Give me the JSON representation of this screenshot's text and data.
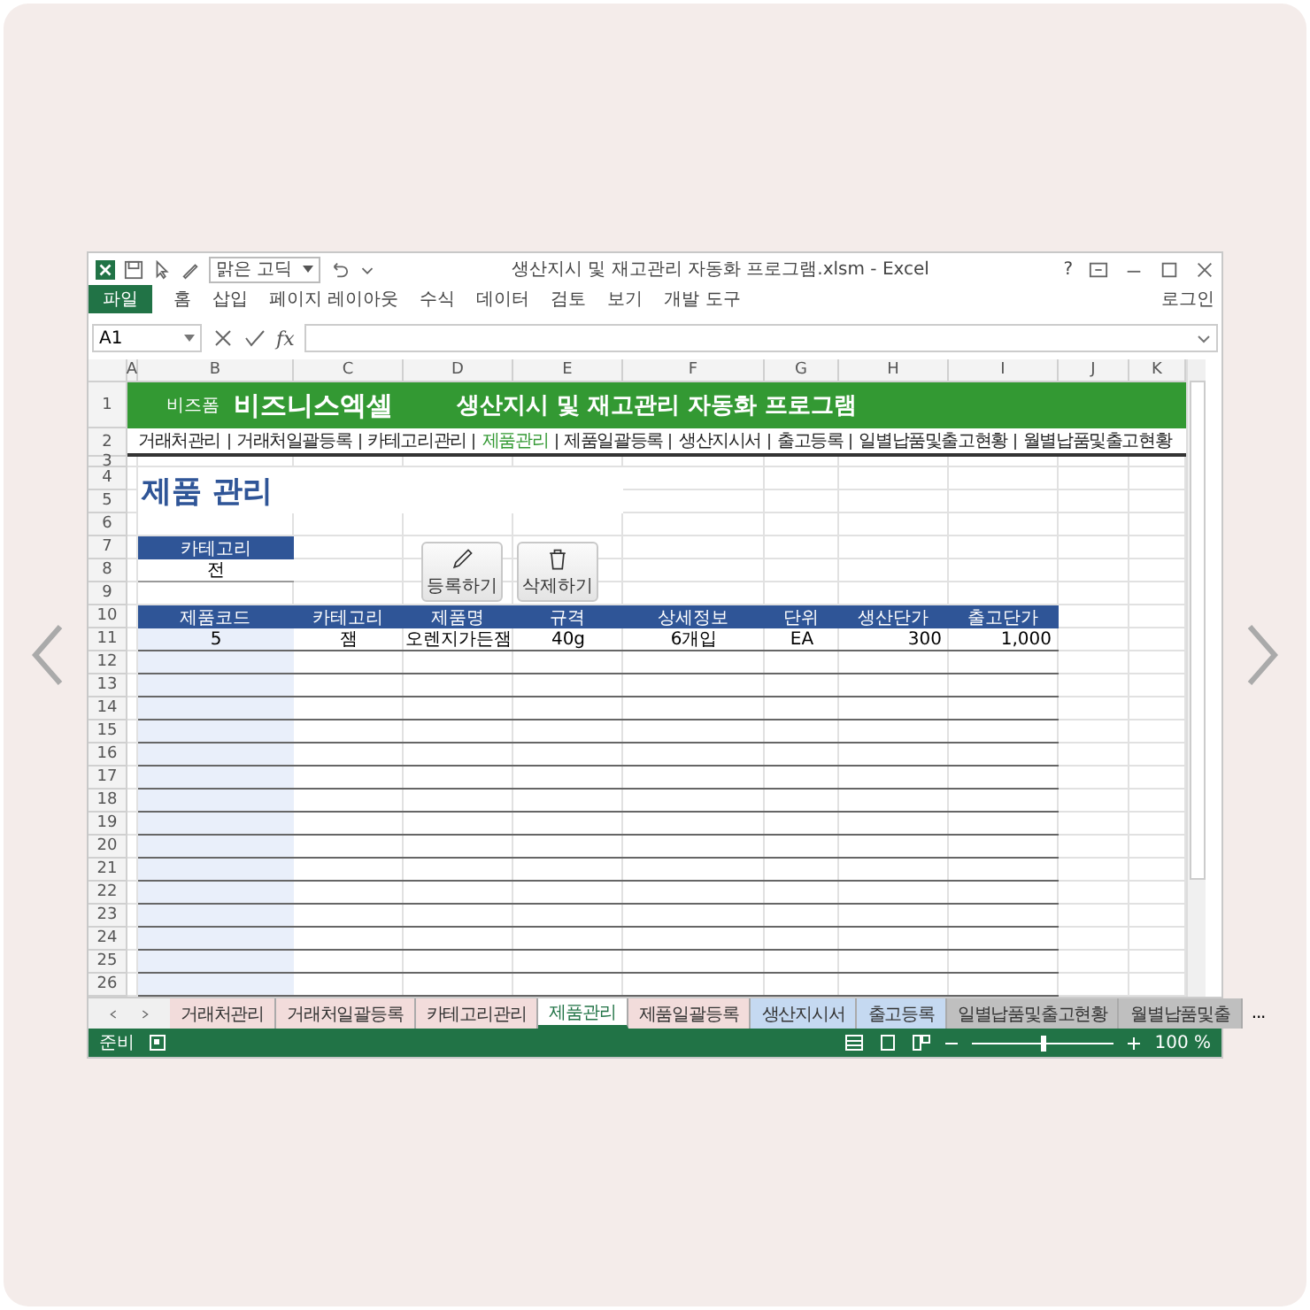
{
  "window": {
    "font_box": "맑은 고딕",
    "title": "생산지시 및 재고관리 자동화 프로그램.xlsm - Excel",
    "help": "?",
    "sign_in": "로그인"
  },
  "ribbon_tabs": [
    {
      "label": "파일",
      "kind": "file"
    },
    {
      "label": "홈",
      "kind": "tab"
    },
    {
      "label": "삽입",
      "kind": "tab"
    },
    {
      "label": "페이지 레이아웃",
      "kind": "tab"
    },
    {
      "label": "수식",
      "kind": "tab"
    },
    {
      "label": "데이터",
      "kind": "tab"
    },
    {
      "label": "검토",
      "kind": "tab"
    },
    {
      "label": "보기",
      "kind": "tab"
    },
    {
      "label": "개발 도구",
      "kind": "tab"
    }
  ],
  "formula_bar": {
    "name_box": "A1",
    "fx": "fx"
  },
  "columns": [
    "A",
    "B",
    "C",
    "D",
    "E",
    "F",
    "G",
    "H",
    "I",
    "J",
    "K"
  ],
  "row_numbers": [
    "1",
    "2",
    "3",
    "4",
    "5",
    "6",
    "7",
    "8",
    "9",
    "10",
    "11",
    "12",
    "13",
    "14",
    "15",
    "16",
    "17",
    "18",
    "19",
    "20",
    "21",
    "22",
    "23",
    "24",
    "25",
    "26"
  ],
  "banner": {
    "brand_small": "비즈폼",
    "brand": "비즈니스엑셀",
    "title": "생산지시 및 재고관리 자동화 프로그램"
  },
  "nav": [
    {
      "label": "거래처관리",
      "selected": false
    },
    {
      "label": "거래처일괄등록",
      "selected": false
    },
    {
      "label": "카테고리관리",
      "selected": false
    },
    {
      "label": "제품관리",
      "selected": true
    },
    {
      "label": "제품일괄등록",
      "selected": false
    },
    {
      "label": "생산지시서",
      "selected": false
    },
    {
      "label": "출고등록",
      "selected": false
    },
    {
      "label": "일별납품및출고현황",
      "selected": false
    },
    {
      "label": "월별납품및출고현황",
      "selected": false
    }
  ],
  "page_title": "제품 관리",
  "category_filter": {
    "label": "카테고리",
    "value": "전"
  },
  "buttons": [
    {
      "label": "등록하기",
      "kind": "edit"
    },
    {
      "label": "삭제하기",
      "kind": "delete"
    }
  ],
  "table": {
    "columns": [
      "제품코드",
      "카테고리",
      "제품명",
      "규격",
      "상세정보",
      "단위",
      "생산단가",
      "출고단가"
    ],
    "rows": [
      [
        "5",
        "잼",
        "오렌지가든잼",
        "40g",
        "6개입",
        "EA",
        "300",
        "1,000"
      ]
    ]
  },
  "sheet_tabs": [
    {
      "label": "거래처관리",
      "color": "#f2dcdb",
      "selected": false
    },
    {
      "label": "거래처일괄등록",
      "color": "#f2dcdb",
      "selected": false
    },
    {
      "label": "카테고리관리",
      "color": "#f2dcdb",
      "selected": false
    },
    {
      "label": "제품관리",
      "selected": true
    },
    {
      "label": "제품일괄등록",
      "color": "#f2dcdb",
      "selected": false
    },
    {
      "label": "생산지시서",
      "color": "#c5d9f1",
      "selected": false
    },
    {
      "label": "출고등록",
      "color": "#c5d9f1",
      "selected": false
    },
    {
      "label": "일별납품및출고현황",
      "color": "#bfbfbf",
      "selected": false
    },
    {
      "label": "월별납품및출",
      "color": "#bfbfbf",
      "selected": false
    }
  ],
  "more_tabs": "...",
  "status_bar": {
    "status": "준비",
    "zoom": "100 %",
    "zoom_slider": {
      "level": 0.5
    }
  }
}
